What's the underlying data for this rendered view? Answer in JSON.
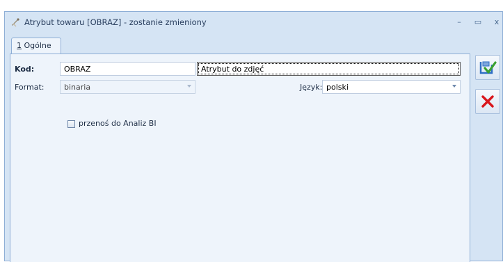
{
  "window": {
    "title": "Atrybut towaru [OBRAZ] - zostanie zmieniony",
    "minimize_glyph": "–",
    "maximize_glyph": "▭",
    "close_glyph": "x"
  },
  "tabs": [
    {
      "accel": "1",
      "label": " Ogólne"
    }
  ],
  "form": {
    "kod_label": "Kod:",
    "kod_value": "OBRAZ",
    "name_value": "Atrybut do zdjęć",
    "format_label": "Format:",
    "format_value": "binaria",
    "jezyk_label": "Język:",
    "jezyk_value": "polski",
    "bi_checkbox_label": "przenoś do Analiz BI",
    "bi_checked": false
  },
  "side_buttons": [
    {
      "name": "save",
      "icon": "save-check-icon"
    },
    {
      "name": "cancel",
      "icon": "red-x-icon"
    }
  ],
  "colors": {
    "window_bg": "#d5e4f4",
    "panel_bg": "#eef4fb",
    "border": "#8eaed6",
    "cancel_red": "#d9161c",
    "save_blue": "#2f6fc4",
    "save_green": "#3aa02f"
  }
}
